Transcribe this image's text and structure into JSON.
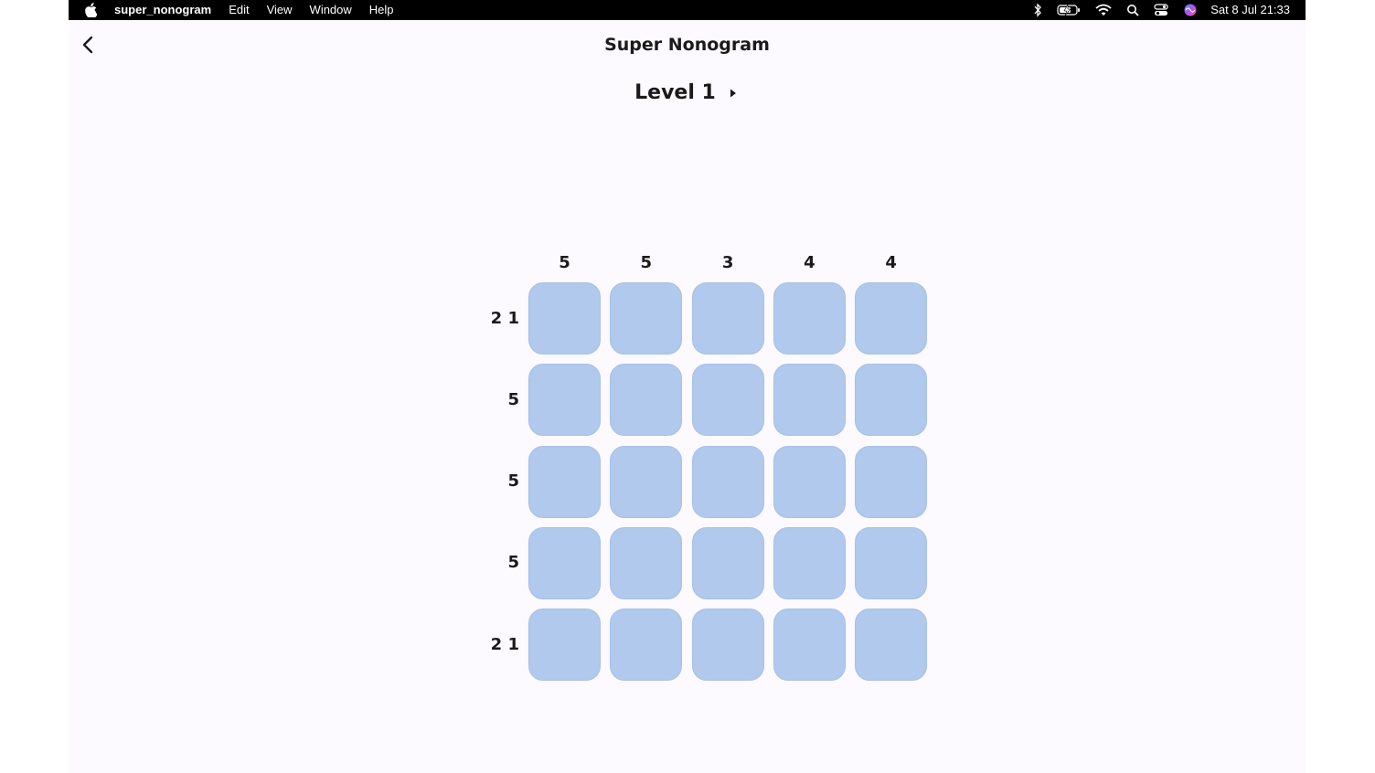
{
  "menubar": {
    "app_name": "super_nonogram",
    "menus": [
      "Edit",
      "View",
      "Window",
      "Help"
    ],
    "clock": "Sat 8 Jul  21:33",
    "status_icons": [
      "bluetooth-icon",
      "battery-charging-icon",
      "wifi-icon",
      "search-icon",
      "control-center-icon",
      "siri-icon"
    ]
  },
  "header": {
    "title": "Super Nonogram",
    "level": "Level 1"
  },
  "puzzle": {
    "col_clues": [
      "5",
      "5",
      "3",
      "4",
      "4"
    ],
    "row_clues": [
      "2 1",
      "5",
      "5",
      "5",
      "2 1"
    ],
    "cells": [
      [
        0,
        0,
        0,
        0,
        0
      ],
      [
        0,
        0,
        0,
        0,
        0
      ],
      [
        0,
        0,
        0,
        0,
        0
      ],
      [
        0,
        0,
        0,
        0,
        0
      ],
      [
        0,
        0,
        0,
        0,
        0
      ]
    ]
  },
  "colors": {
    "background": "#fcfaff",
    "cell_empty": "#b0c9ec",
    "text": "#1a1a1a"
  }
}
